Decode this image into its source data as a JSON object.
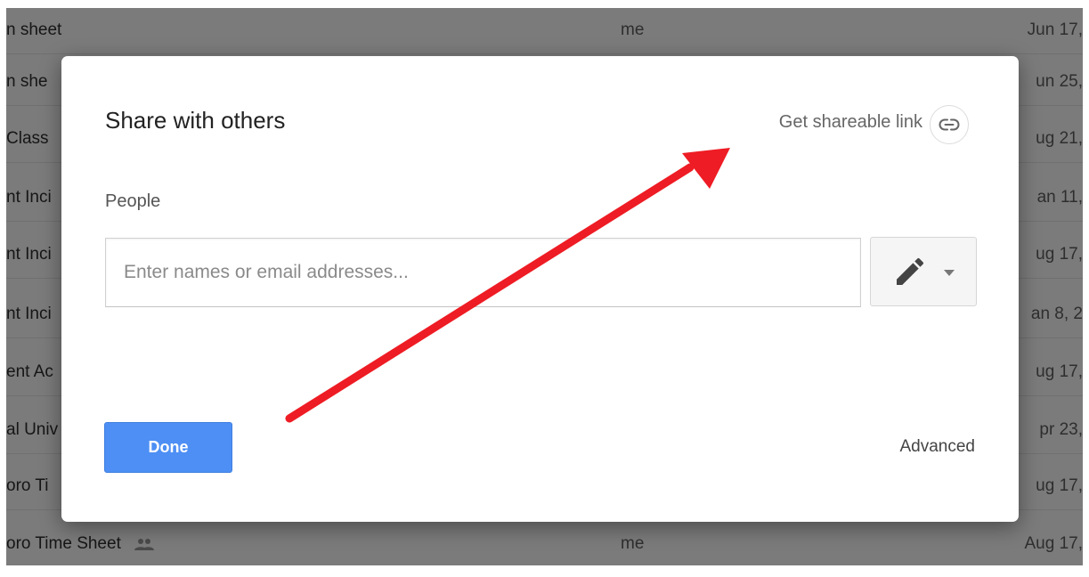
{
  "file_list": {
    "rows": [
      {
        "name": "n sheet",
        "owner": "me",
        "date": "Jun 17,"
      },
      {
        "name": "n she",
        "owner": "",
        "date": "un 25,"
      },
      {
        "name": "Class",
        "owner": "",
        "date": "ug 21,"
      },
      {
        "name": "nt Inci",
        "owner": "",
        "date": "an 11,"
      },
      {
        "name": "nt Inci",
        "owner": "",
        "date": "ug 17,"
      },
      {
        "name": "nt Inci",
        "owner": "",
        "date": "an 8, 2"
      },
      {
        "name": "ent Ac",
        "owner": "",
        "date": "ug 17,"
      },
      {
        "name": "al Univ",
        "owner": "",
        "date": "pr 23,"
      },
      {
        "name": "oro Ti",
        "owner": "",
        "date": "ug 17,"
      },
      {
        "name": "oro Time Sheet",
        "owner": "me",
        "date": "Aug 17,",
        "shared_icon": "people-icon"
      }
    ]
  },
  "dialog": {
    "title": "Share with others",
    "shareable_link_label": "Get shareable link",
    "link_icon": "link-icon",
    "people_label": "People",
    "people_input": {
      "value": "",
      "placeholder": "Enter names or email addresses..."
    },
    "permission_button": {
      "icon": "pencil-icon",
      "caret": "caret-down-icon"
    },
    "done_label": "Done",
    "advanced_label": "Advanced"
  },
  "annotation": {
    "type": "arrow",
    "color": "#ee1c24",
    "points_to": "Get shareable link"
  },
  "colors": {
    "primary_button": "#4d8ff4",
    "overlay": "rgba(0,0,0,0.46)",
    "arrow": "#ee1c24"
  }
}
